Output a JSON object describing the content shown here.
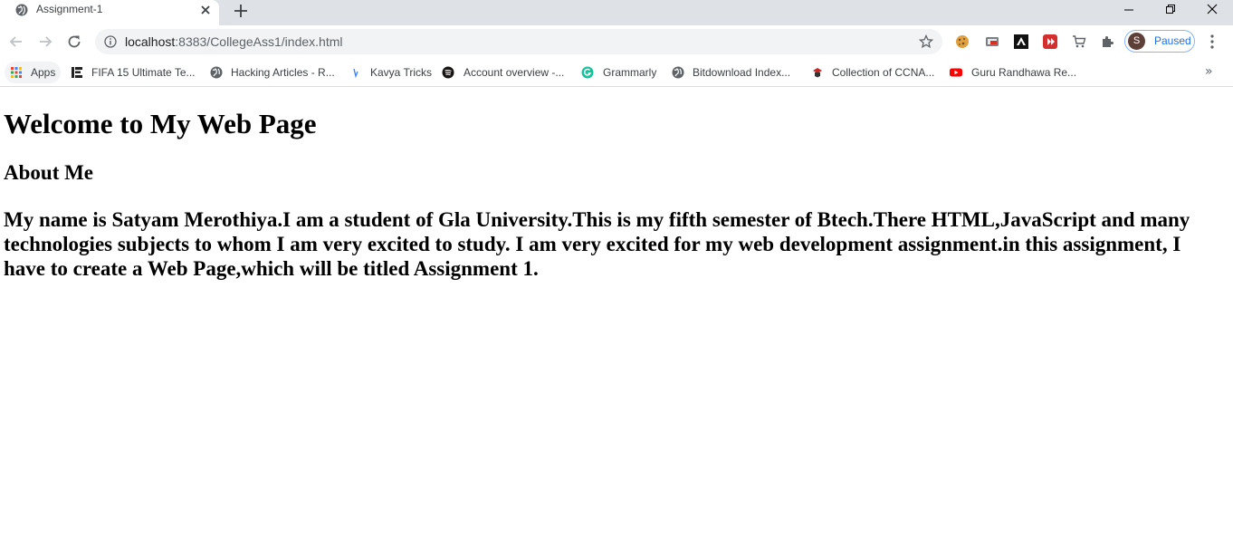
{
  "browser": {
    "tab_title": "Assignment-1",
    "url_host": "localhost",
    "url_rest": ":8383/CollegeAss1/index.html",
    "profile_initial": "S",
    "profile_status": "Paused",
    "bookmarks": [
      {
        "label": "Apps",
        "icon": "apps-grid-icon"
      },
      {
        "label": "FIFA 15 Ultimate Te...",
        "icon": "fifa-icon"
      },
      {
        "label": "Hacking Articles - R...",
        "icon": "globe-icon"
      },
      {
        "label": "Kavya Tricks",
        "icon": "kavya-icon"
      },
      {
        "label": "Account overview -...",
        "icon": "spotify-icon"
      },
      {
        "label": "Grammarly",
        "icon": "grammarly-icon"
      },
      {
        "label": "Bitdownload Index...",
        "icon": "globe-icon"
      },
      {
        "label": "Collection of CCNA...",
        "icon": "ccna-icon"
      },
      {
        "label": "Guru Randhawa Re...",
        "icon": "youtube-icon"
      }
    ],
    "bookmarks_overflow": "»"
  },
  "page": {
    "heading": "Welcome to My Web Page",
    "subheading": "About Me",
    "paragraph": "My name is Satyam Merothiya.I am a student of Gla University.This is my fifth semester of Btech.There HTML,JavaScript and many technologies subjects to whom I am very excited to study. I am very excited for my web development assignment.in this assignment, I have to create a Web Page,which will be titled Assignment 1."
  },
  "colors": {
    "tabstrip": "#dee1e6",
    "omnibox": "#f1f3f4",
    "accent": "#1a73e8"
  }
}
